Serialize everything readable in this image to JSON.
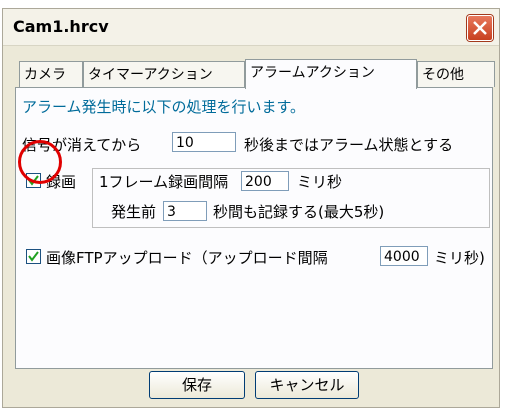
{
  "window": {
    "title": "Cam1.hrcv"
  },
  "tabs": [
    {
      "label": "カメラ"
    },
    {
      "label": "タイマーアクション"
    },
    {
      "label": "アラームアクション"
    },
    {
      "label": "その他"
    }
  ],
  "panel": {
    "description": "アラーム発生時に以下の処理を行います。",
    "signal": {
      "prefix": "信号が消えてから",
      "value": "10",
      "suffix": "秒後まではアラーム状態とする"
    },
    "recording": {
      "checkbox_label": "録画",
      "checked": true,
      "interval_label": "1フレーム録画間隔",
      "interval_value": "200",
      "interval_unit": "ミリ秒",
      "pre_label": "発生前",
      "pre_value": "3",
      "pre_suffix": "秒間も記録する(最大5秒)"
    },
    "ftp": {
      "checked": true,
      "label": "画像FTPアップロード（アップロード間隔",
      "value": "4000",
      "unit": "ミリ秒)"
    }
  },
  "buttons": {
    "save": "保存",
    "cancel": "キャンセル"
  },
  "colors": {
    "accent": "#006b9a",
    "highlight": "#e00000",
    "close": "#c8401f"
  },
  "icons": {
    "close": "close-icon",
    "check": "checkmark-icon"
  }
}
